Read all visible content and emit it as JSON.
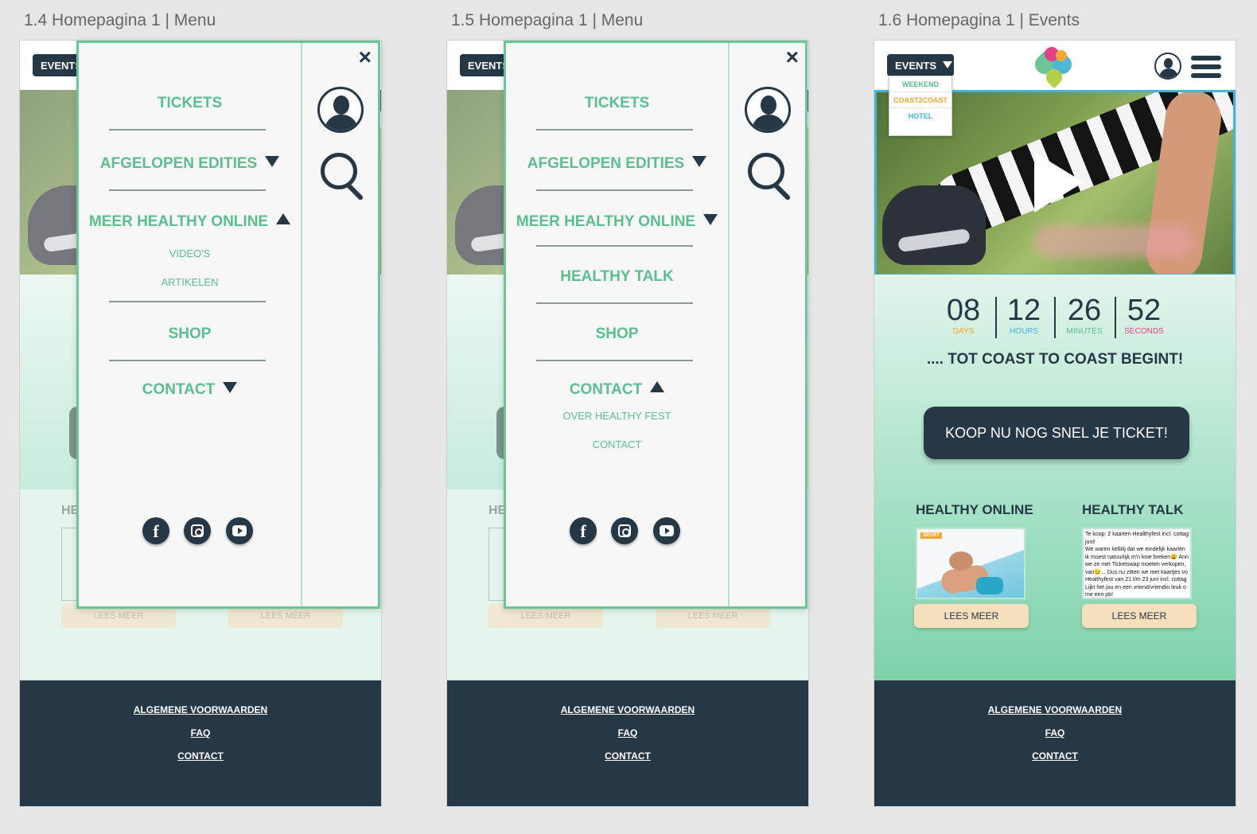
{
  "artboards": [
    {
      "title": "1.4 Homepagina 1 | Menu"
    },
    {
      "title": "1.5 Homepagina 1 | Menu"
    },
    {
      "title": "1.6 Homepagina 1 | Events"
    }
  ],
  "header": {
    "events_label": "EVENTS"
  },
  "menu14": {
    "tickets": "TICKETS",
    "afgelopen": "AFGELOPEN EDITIES",
    "meer": "MEER HEALTHY ONLINE",
    "sub1": "VIDEO'S",
    "sub2": "ARTIKELEN",
    "shop": "SHOP",
    "contact": "CONTACT"
  },
  "menu15": {
    "tickets": "TICKETS",
    "afgelopen": "AFGELOPEN EDITIES",
    "meer": "MEER HEALTHY ONLINE",
    "talk": "HEALTHY TALK",
    "shop": "SHOP",
    "contact": "CONTACT",
    "sub1": "OVER HEALTHY FEST",
    "sub2": "CONTACT"
  },
  "menu_close": "×",
  "ghost": {
    "heading": "HE",
    "lees": "LEES MEER"
  },
  "events_dropdown": [
    "WEEKEND",
    "COAST2COAST",
    "HOTEL"
  ],
  "dropdown_colors": [
    "#5bbf8d",
    "#f3a734",
    "#43b4d8"
  ],
  "countdown": [
    {
      "value": "08",
      "label": "DAYS",
      "color": "#f3a734"
    },
    {
      "value": "12",
      "label": "HOURS",
      "color": "#43b4d8"
    },
    {
      "value": "26",
      "label": "MINUTES",
      "color": "#5bbf8d"
    },
    {
      "value": "52",
      "label": "SECONDS",
      "color": "#e3418b"
    }
  ],
  "begin_text": ".... TOT COAST TO COAST BEGINT!",
  "cta": "KOOP NU NOG SNEL JE TICKET!",
  "sections": {
    "online": "HEALTHY ONLINE",
    "talk": "HEALTHY TALK",
    "tag": "SPORT",
    "lees": "LEES MEER",
    "talk_text": [
      "Te koop: 2 kaarten Healthyfest incl. cottag",
      "juni!",
      "We waren kelblij dat we eindelijk kaarten",
      "ik moest natuurlijk m'n knie breken😩 Ann",
      "we ze met Ticketswap moeten verkopen,",
      "van😏... Dus nu zitten we met kaartjes vo",
      "Healthyfest van 21 t/m 23 juni incl. cottag",
      "Lijkt het jou en een vriend/vriendin leuk o",
      "me een pb!"
    ]
  },
  "footer": {
    "link1": "ALGEMENE VOORWAARDEN",
    "link2": "FAQ",
    "link3": "CONTACT"
  }
}
